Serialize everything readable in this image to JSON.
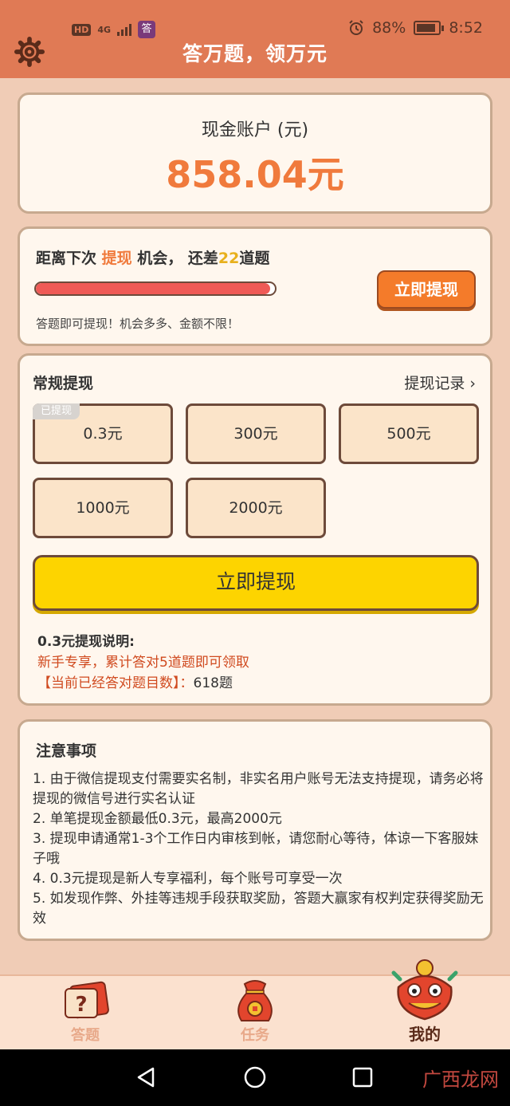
{
  "status": {
    "battery": "88%",
    "battery_level": 0.88,
    "time": "8:52",
    "hd": "HD",
    "net": "4G",
    "app_badge": "答"
  },
  "header": {
    "title": "答万题，领万元",
    "settings_icon": "gear-icon"
  },
  "cash": {
    "label": "现金账户 (元)",
    "amount": "858.04元"
  },
  "next": {
    "prefix": "距离下次",
    "keyword": "提现",
    "middle": "机会，  还差",
    "count": "22",
    "suffix": "道题",
    "progress": 0.98,
    "button": "立即提现",
    "note": "答题即可提现！机会多多、金额不限！"
  },
  "withdraw": {
    "title": "常规提现",
    "record_link": "提现记录",
    "options": [
      "0.3元",
      "300元",
      "500元",
      "1000元",
      "2000元"
    ],
    "used_tag": "已提现",
    "button": "立即提现",
    "explain_title": "0.3元提现说明:",
    "explain_line1": "新手专享，累计答对5道题即可领取",
    "explain_line2_label": "【当前已经答对题目数】：",
    "explain_line2_value": "618题"
  },
  "notice": {
    "title": "注意事项",
    "items": [
      "1. 由于微信提现支付需要实名制，非实名用户账号无法支持提现，请务必将提现的微信号进行实名认证",
      "2. 单笔提现金额最低0.3元，最高2000元",
      "3. 提现申请通常1-3个工作日内审核到帐，请您耐心等待，体谅一下客服妹子哦",
      "4. 0.3元提现是新人专享福利，每个账号可享受一次",
      "5. 如发现作弊、外挂等违规手段获取奖励，答题大赢家有权判定获得奖励无效"
    ]
  },
  "tabs": [
    {
      "label": "答题",
      "icon": "question-card-icon"
    },
    {
      "label": "任务",
      "icon": "lucky-bag-icon"
    },
    {
      "label": "我的",
      "icon": "lion-dance-icon"
    }
  ],
  "watermark": "广西龙网",
  "colors": {
    "header": "#e07a55",
    "accent": "#f07a3c",
    "button_yellow": "#fdd400",
    "progress": "#ef5a56"
  }
}
